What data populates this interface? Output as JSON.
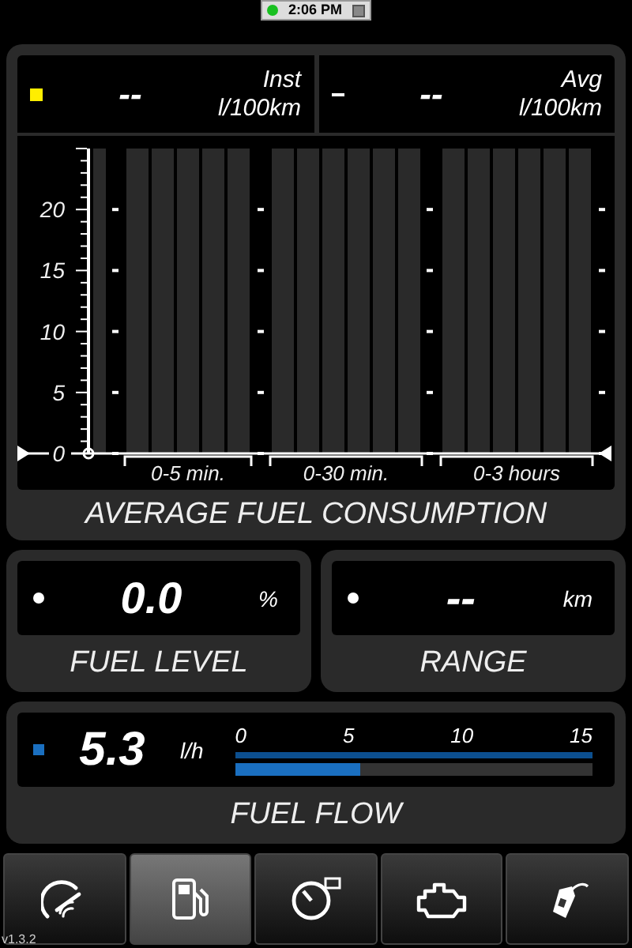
{
  "status_bar": {
    "time": "2:06 PM"
  },
  "consumption": {
    "title": "AVERAGE FUEL CONSUMPTION",
    "readouts": [
      {
        "kind": "square",
        "color": "#ffee00",
        "value": "--",
        "label": "Inst",
        "unit": "l/100km"
      },
      {
        "kind": "line",
        "color": "#ffffff",
        "value": "--",
        "label": "Avg",
        "unit": "l/100km"
      }
    ],
    "chart_data": {
      "type": "bar",
      "categories": [
        "0-5 min.",
        "0-30 min.",
        "0-3 hours"
      ],
      "yticks": [
        0,
        5,
        10,
        15,
        20
      ],
      "ylim": [
        0,
        25
      ],
      "values": [
        null,
        null,
        null
      ]
    }
  },
  "fuel_level": {
    "title": "FUEL LEVEL",
    "value": "0.0",
    "unit": "%"
  },
  "range": {
    "title": "RANGE",
    "value": "--",
    "unit": "km"
  },
  "fuel_flow": {
    "title": "FUEL FLOW",
    "value": "5.3",
    "unit": "l/h",
    "scale": [
      "0",
      "5",
      "10",
      "15"
    ],
    "level": 0.35
  },
  "nav": [
    {
      "kind": "gauge",
      "selected": false
    },
    {
      "kind": "pump",
      "selected": true
    },
    {
      "kind": "speedometer",
      "selected": false
    },
    {
      "kind": "engine",
      "selected": false
    },
    {
      "kind": "nozzle",
      "selected": false
    }
  ],
  "version": "v1.3.2"
}
